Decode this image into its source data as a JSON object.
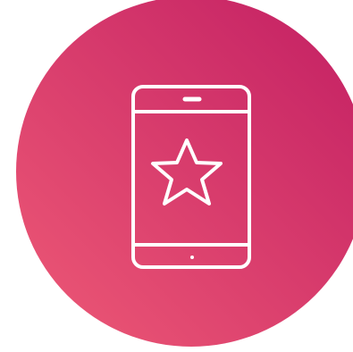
{
  "badge": {
    "icon": "smartphone-star-icon",
    "gradient_start": "#ee5a76",
    "gradient_end": "#c21e63",
    "line_color": "#ffffff",
    "background": "#ffffff"
  }
}
